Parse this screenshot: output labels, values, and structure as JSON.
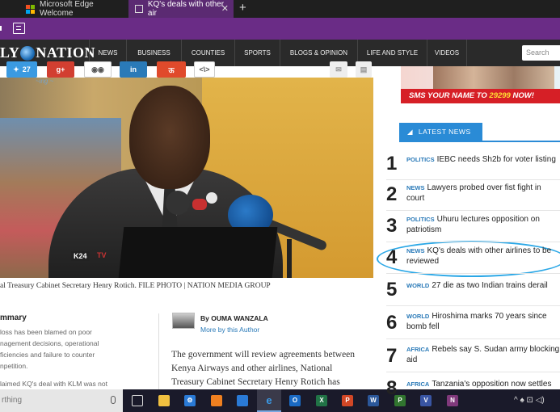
{
  "browser": {
    "tabs": [
      {
        "label": "Microsoft Edge Welcome",
        "active": false
      },
      {
        "label": "KQ's deals with other air",
        "active": true
      }
    ],
    "new_tab_symbol": "+",
    "close_symbol": "✕",
    "accent_color": "#6a2c86"
  },
  "site": {
    "logo_left": "LY",
    "logo_right": "NATION",
    "nav": [
      "NEWS",
      "BUSINESS",
      "COUNTIES",
      "SPORTS",
      "BLOGS & OPINION",
      "LIFE AND STYLE",
      "VIDEOS"
    ],
    "search_placeholder": "Search"
  },
  "share": {
    "twitter_count": "27",
    "gplus": "g+",
    "linkedin": "in",
    "reddit": "ऊ",
    "more": "<\\>"
  },
  "photo": {
    "tag": "~ing ~",
    "camera_label_1": "K24",
    "camera_label_2": "TV",
    "caption": "al Treasury Cabinet Secretary Henry Rotich. FILE PHOTO | NATION MEDIA GROUP"
  },
  "summary": {
    "title": "mmary",
    "lines": [
      "loss has been blamed on poor",
      "nagement decisions, operational",
      "ficiencies and failure to counter",
      "npetition.",
      "",
      "laimed KQ's deal with KLM was not"
    ]
  },
  "byline": {
    "author": "By OUMA WANZALA",
    "more_link": "More by this Author"
  },
  "article_body": [
    "The government will review agreements between",
    "Kenya Airways and other airlines, National",
    "Treasury Cabinet Secretary Henry Rotich has"
  ],
  "ad": {
    "banner_text": "SMS YOUR NAME TO",
    "phone": "29299",
    "banner_end": "NOW!"
  },
  "latest_news": {
    "title": "LATEST NEWS",
    "items": [
      {
        "num": "1",
        "cat": "POLITICS",
        "line1": "IEBC needs Sh2b for voter listing",
        "line2": ""
      },
      {
        "num": "2",
        "cat": "NEWS",
        "line1": "Lawyers probed over fist fight in",
        "line2": "court"
      },
      {
        "num": "3",
        "cat": "POLITICS",
        "line1": "Uhuru lectures opposition on",
        "line2": "patriotism"
      },
      {
        "num": "4",
        "cat": "NEWS",
        "line1": "KQ's deals with other airlines to be",
        "line2": "reviewed"
      },
      {
        "num": "5",
        "cat": "WORLD",
        "line1": "27 die as two Indian trains derail",
        "line2": ""
      },
      {
        "num": "6",
        "cat": "WORLD",
        "line1": "Hiroshima marks 70 years since",
        "line2": "bomb fell"
      },
      {
        "num": "7",
        "cat": "AFRICA",
        "line1": "Rebels say S. Sudan army blocking",
        "line2": "aid"
      },
      {
        "num": "8",
        "cat": "AFRICA",
        "line1": "Tanzania's opposition now settles",
        "line2": ""
      }
    ]
  },
  "taskbar": {
    "search_text": "rthing",
    "apps": [
      "task-view",
      "file-explorer",
      "settings",
      "ms-store",
      "photos",
      "edge",
      "outlook",
      "excel",
      "powerpoint",
      "word",
      "project",
      "visio",
      "onenote"
    ],
    "tray": "^ ♠ ⊡ ◁)"
  }
}
